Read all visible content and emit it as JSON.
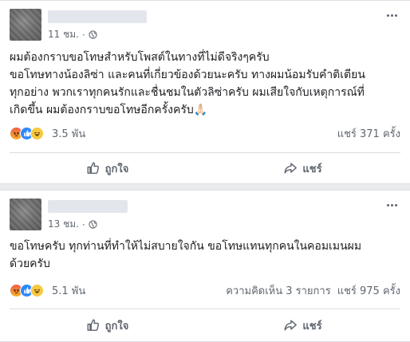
{
  "posts": [
    {
      "time": "11 ชม.",
      "body": "ผมต้องกราบขอโทษสำหรับโพสต์ในทางที่ไม่ดีจริงๆครับ\nขอโทษทางน้องลิซ่า และคนที่เกี่ยวข้องด้วยนะครับ ทางผมน้อมรับคำติเตียน\nทุกอย่าง พวกเราทุกคนรักและชื่นชมในตัวลิซ่าครับ ผมเสียใจกับเหตุการณ์ที่\nเกิดขึ้น ผมต้องกราบขอโทษอีกครั้งครับ🙏🏻",
      "reaction_count": "3.5 พัน",
      "comments": "",
      "shares": "แชร์ 371 ครั้ง",
      "reactions": [
        "angry",
        "like",
        "haha"
      ]
    },
    {
      "time": "13 ชม.",
      "body": "ขอโทษครับ ทุกท่านที่ทำให้ไม่สบายใจกัน ขอโทษแทนทุกคนในคอมเมนผม\nด้วยครับ",
      "reaction_count": "5.1 พัน",
      "comments": "ความคิดเห็น 3 รายการ",
      "shares": "แชร์ 975 ครั้ง",
      "reactions": [
        "angry",
        "like",
        "haha"
      ]
    }
  ],
  "actions": {
    "like_label": "ถูกใจ",
    "share_label": "แชร์"
  },
  "icons": {
    "visibility": "globe-icon",
    "menu": "more-horizontal-icon",
    "like": "thumbs-up-icon",
    "share": "share-arrow-icon"
  },
  "colors": {
    "like_blue": "#2d88ff",
    "haha_yellow": "#f7c843",
    "angry_red": "#f05c48",
    "muted_text": "#606770"
  }
}
